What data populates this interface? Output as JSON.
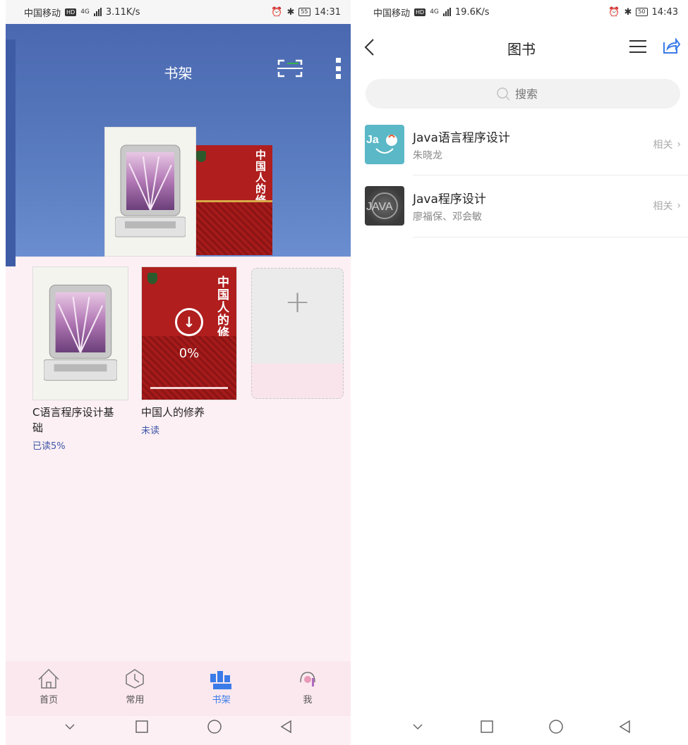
{
  "left_screen": {
    "status": {
      "carrier": "中国移动",
      "hd": "HD",
      "net_type": "4G",
      "speed": "3.11K/s",
      "battery": "55",
      "time": "14:31"
    },
    "header": {
      "title": "书架"
    },
    "books": [
      {
        "title": "C语言程序设计基础",
        "status": "已读5%"
      },
      {
        "title": "中国人的修养",
        "status": "未读",
        "cover_title": "中国人的修养",
        "download_percent": "0%",
        "download_progress": 0
      }
    ],
    "add_button": "+",
    "bottom_nav": [
      {
        "label": "首页",
        "icon": "home-icon"
      },
      {
        "label": "常用",
        "icon": "common-icon"
      },
      {
        "label": "书架",
        "icon": "bookshelf-icon",
        "active": true
      },
      {
        "label": "我",
        "icon": "me-icon"
      }
    ]
  },
  "right_screen": {
    "status": {
      "carrier": "中国移动",
      "hd": "HD",
      "net_type": "4G",
      "speed": "19.6K/s",
      "battery": "50",
      "time": "14:43"
    },
    "header": {
      "title": "图书"
    },
    "search": {
      "placeholder": "搜索"
    },
    "results": [
      {
        "title": "Java语言程序设计",
        "author": "朱晓龙",
        "action": "相关"
      },
      {
        "title": "Java程序设计",
        "author": "廖福保、邓会敏",
        "action": "相关"
      }
    ]
  },
  "colors": {
    "accent": "#3b7be8",
    "banner": "#5a7cc0",
    "read_status": "#3d56a8"
  }
}
